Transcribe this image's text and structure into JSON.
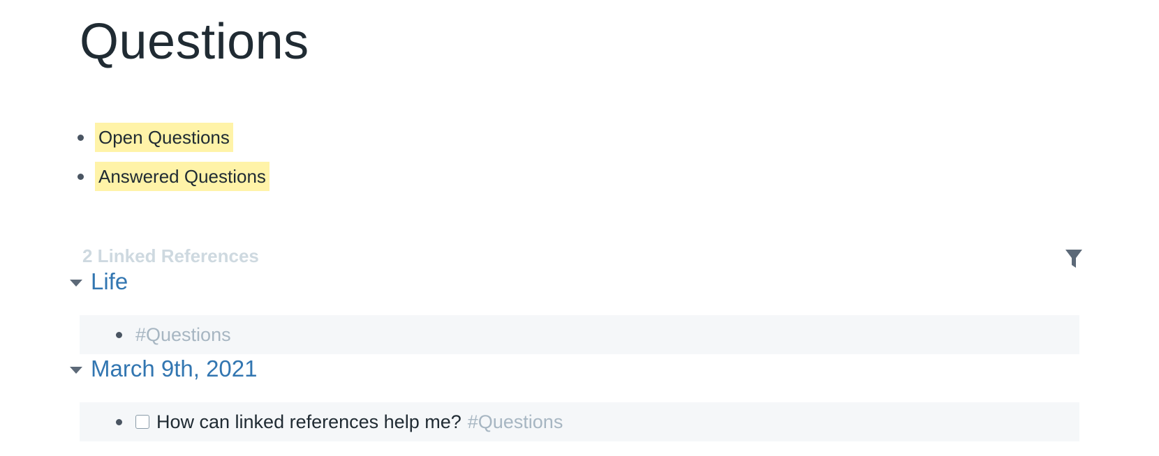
{
  "page": {
    "title": "Questions"
  },
  "blocks": [
    {
      "label": "Open Questions"
    },
    {
      "label": "Answered Questions"
    }
  ],
  "linked_references": {
    "header": "2 Linked References",
    "filter_icon": "filter-icon",
    "groups": [
      {
        "title": "Life",
        "items": [
          {
            "tag": "#Questions"
          }
        ]
      },
      {
        "title": "March 9th, 2021",
        "items": [
          {
            "todo_checked": false,
            "text": "How can linked references help me?",
            "tag": "#Questions"
          }
        ]
      }
    ]
  },
  "colors": {
    "highlight": "#fff3a8",
    "link": "#3276b1",
    "muted_tag": "#a7b6c2",
    "ref_header": "#ced9e0",
    "ref_background": "#f5f7f9"
  }
}
